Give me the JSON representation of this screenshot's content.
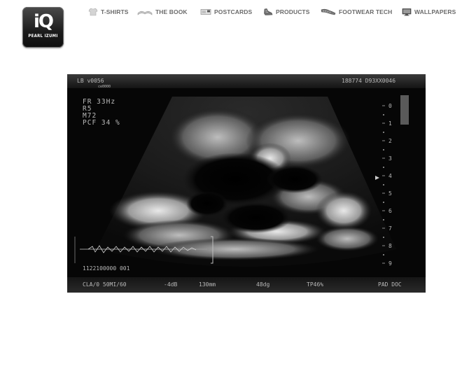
{
  "logo": {
    "mark": "iQ",
    "text": "PEARL IZUMI"
  },
  "nav": {
    "items": [
      {
        "label": "T-SHIRTS",
        "icon": "tshirt-icon"
      },
      {
        "label": "THE BOOK",
        "icon": "book-icon"
      },
      {
        "label": "POSTCARDS",
        "icon": "postcard-icon"
      },
      {
        "label": "PRODUCTS",
        "icon": "shoe-icon"
      },
      {
        "label": "FOOTWEAR TECH",
        "icon": "footwear-sole-icon"
      },
      {
        "label": "WALLPAPERS",
        "icon": "monitor-icon"
      }
    ]
  },
  "ultrasound": {
    "top_left": "LB  v0056",
    "top_left_sub": "ce0000",
    "top_right": "188774 D93XX0046",
    "params": [
      "FR  33Hz",
      "R5",
      "M72",
      "PCF  34 %"
    ],
    "depth_scale": [
      "0",
      "1",
      "2",
      "3",
      "4",
      "5",
      "6",
      "7",
      "8",
      "9"
    ],
    "bottom_left_id": "1122100000 001",
    "bottom_bar": [
      "CLA/0 50MI/60",
      "-4dB",
      "130mm",
      "48dg",
      "TP46%",
      "PAD DOC"
    ]
  }
}
